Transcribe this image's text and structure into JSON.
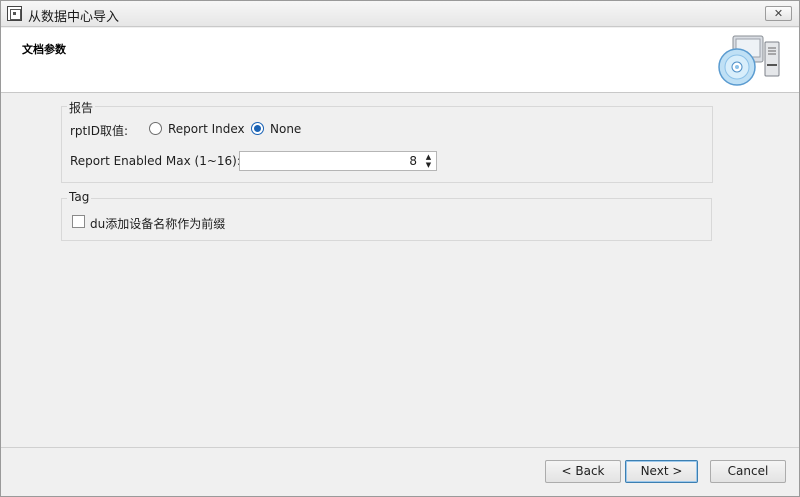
{
  "window": {
    "title": "从数据中心导入",
    "close_label": "✕"
  },
  "header": {
    "title": "文档参数",
    "graphic_icon": "setup-disk-computer-icon"
  },
  "report_group": {
    "title": "报告",
    "rptid_label": "rptID取值:",
    "options": [
      {
        "label": "Report Index",
        "checked": false
      },
      {
        "label": "None",
        "checked": true
      }
    ],
    "max_label": "Report Enabled Max (1~16):",
    "max_value": "8"
  },
  "tag_group": {
    "title": "Tag",
    "checkbox_label": "du添加设备名称作为前缀",
    "checked": false
  },
  "buttons": {
    "back_label": "< Back",
    "next_label": "Next >",
    "cancel_label": "Cancel"
  },
  "colors": {
    "accent": "#1b63b5",
    "header_bg": "#ffffff",
    "body_bg": "#f0f0f0"
  }
}
